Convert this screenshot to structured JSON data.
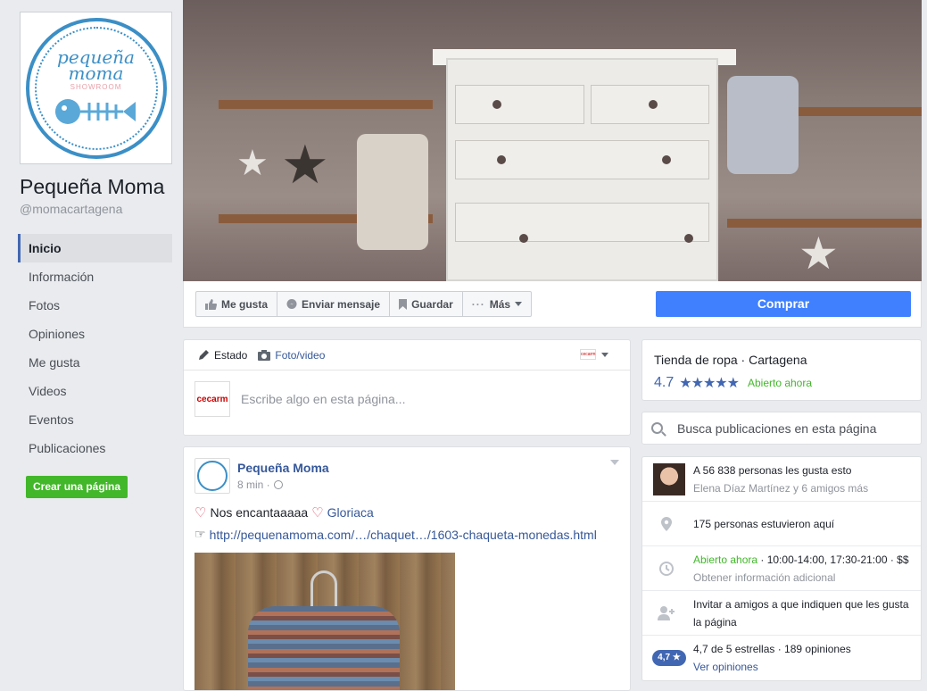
{
  "page": {
    "name": "Pequeña Moma",
    "handle": "@momacartagena",
    "logo": {
      "line1": "pequeña",
      "line2": "moma",
      "line3": "SHOWROOM"
    }
  },
  "nav": {
    "items": [
      {
        "label": "Inicio",
        "active": true
      },
      {
        "label": "Información"
      },
      {
        "label": "Fotos"
      },
      {
        "label": "Opiniones"
      },
      {
        "label": "Me gusta"
      },
      {
        "label": "Videos"
      },
      {
        "label": "Eventos"
      },
      {
        "label": "Publicaciones"
      }
    ],
    "create_page": "Crear una página"
  },
  "actions": {
    "like": "Me gusta",
    "message": "Enviar mensaje",
    "save": "Guardar",
    "more": "Más",
    "buy": "Comprar"
  },
  "composer": {
    "tab_status": "Estado",
    "tab_photo": "Foto/video",
    "placeholder": "Escribe algo en esta página...",
    "avatar_text": "cecarm"
  },
  "post": {
    "author": "Pequeña Moma",
    "time": "8 min · ",
    "text": "Nos encantaaaaa",
    "mention": "Gloriaca",
    "link": "http://pequenamoma.com/…/chaquet…/1603-chaqueta-monedas.html"
  },
  "about": {
    "category": "Tienda de ropa · Cartagena",
    "rating": "4.7",
    "stars": "★★★★★",
    "open_now": "Abierto ahora",
    "search_placeholder": "Busca publicaciones en esta página",
    "likes": "A 56 838 personas les gusta esto",
    "likes_friends": "Elena Díaz Martínez y 6 amigos más",
    "checkins": "175 personas estuvieron aquí",
    "hours_open": "Abierto ahora",
    "hours": " · 10:00-14:00, 17:30-21:00 · $$",
    "hours_more": "Obtener información adicional",
    "invite": "Invitar a amigos a que indiquen que les gusta la página",
    "badge": "4,7 ★",
    "rating_text": "4,7 de 5 estrellas · 189 opiniones",
    "see_opinions": "Ver opiniones"
  },
  "colors": {
    "accent": "#4267b2",
    "buy": "#4080ff",
    "green": "#42b72a",
    "link": "#365899"
  }
}
